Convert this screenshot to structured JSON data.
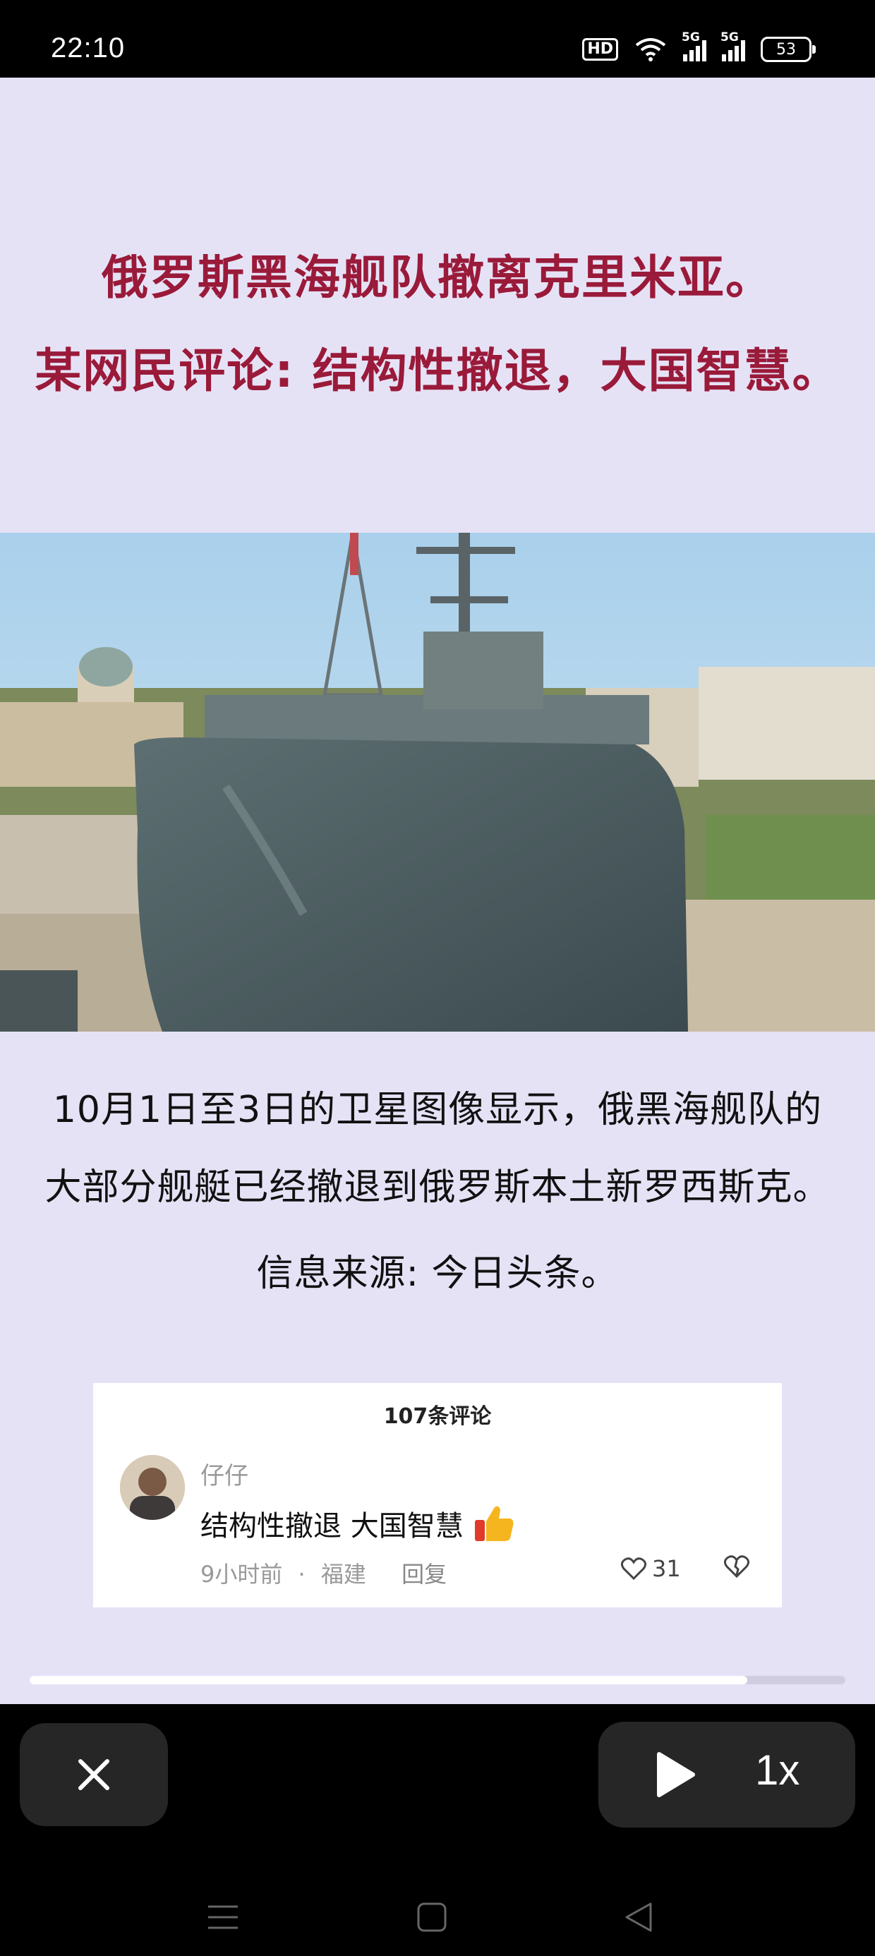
{
  "status_bar": {
    "time": "22:10",
    "hd_label": "HD",
    "network_1": "5G",
    "network_2": "5G",
    "battery": "53"
  },
  "video": {
    "headline_1": "俄罗斯黑海舰队撤离克里米亚。",
    "headline_2": "某网民评论: 结构性撤退，大国智慧。",
    "body_1": "10月1日至3日的卫星图像显示，俄黑海舰队的",
    "body_2": "大部分舰艇已经撤退到俄罗斯本土新罗西斯克。",
    "source": "信息来源: 今日头条。",
    "comment_card": {
      "count": "107条评论",
      "username": "仔仔",
      "text": "结构性撤退 大国智慧",
      "time": "9小时前",
      "location": "福建",
      "separator": "·",
      "reply": "回复",
      "likes": "31"
    },
    "progress": 0.88
  },
  "controls": {
    "speed": "1x"
  },
  "icons": {
    "close": "close-icon",
    "play": "play-icon",
    "thumbs_up": "thumbs-up-icon",
    "heart": "heart-icon",
    "dislike": "dislike-icon"
  },
  "colors": {
    "headline": "#9a1a3a",
    "background": "#e6e2f6",
    "control_bg": "#262626"
  }
}
